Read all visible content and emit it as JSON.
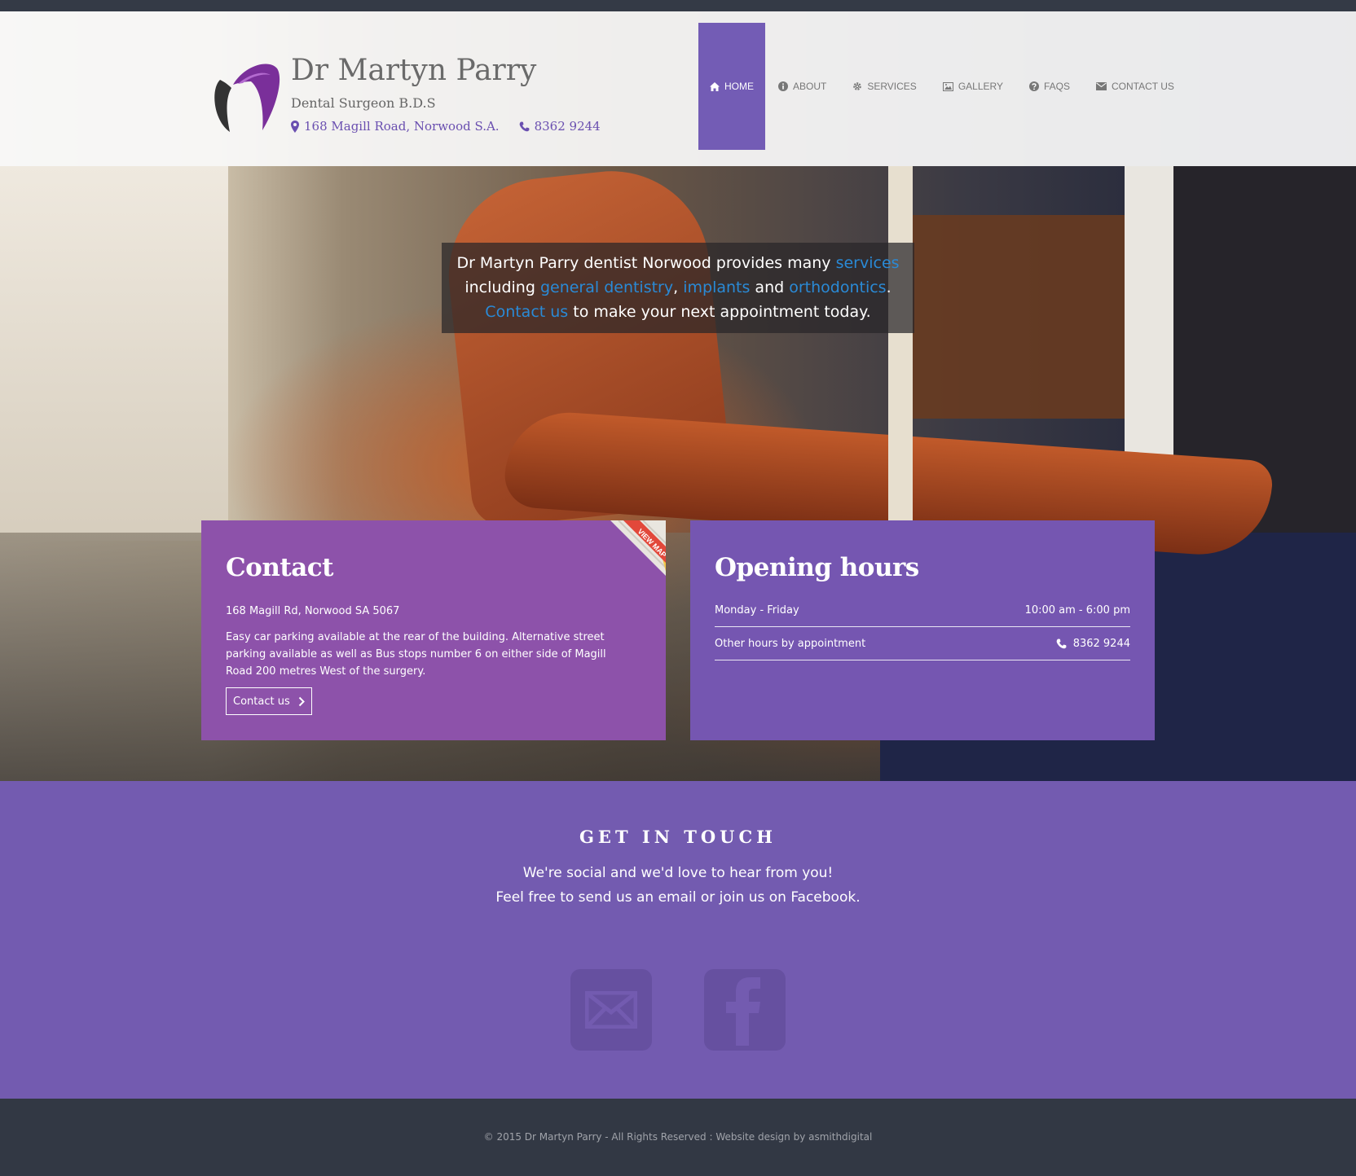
{
  "brand": {
    "name": "Dr Martyn Parry",
    "subtitle": "Dental Surgeon B.D.S",
    "address": "168 Magill Road, Norwood S.A.",
    "phone": "8362 9244",
    "accent": "#735cb5"
  },
  "nav": {
    "items": [
      {
        "label": "HOME",
        "icon": "home-icon"
      },
      {
        "label": "ABOUT",
        "icon": "info-icon"
      },
      {
        "label": "SERVICES",
        "icon": "gear-icon"
      },
      {
        "label": "GALLERY",
        "icon": "image-icon"
      },
      {
        "label": "FAQS",
        "icon": "question-icon"
      },
      {
        "label": "CONTACT US",
        "icon": "mail-icon"
      }
    ],
    "active": "HOME"
  },
  "intro": {
    "l1_a": "Dr Martyn Parry dentist Norwood provides many ",
    "l1_link": "services",
    "l2_a": "including ",
    "l2_link1": "general dentistry",
    "l2_sep": ", ",
    "l2_link2": "implants",
    "l2_b": " and ",
    "l2_link3": "orthodontics",
    "l2_end": ".",
    "l3_link": "Contact us",
    "l3_b": " to make your next appointment today."
  },
  "contact_card": {
    "title": "Contact",
    "address": "168 Magill Rd, Norwood SA 5067",
    "description": "Easy car parking available at the rear of the building. Alternative street parking available as well as Bus stops number 6 on either side of Magill Road 200 metres West of the surgery.",
    "button": "Contact us",
    "ribbon": "VIEW MAP",
    "color": "#8d52aa"
  },
  "hours_card": {
    "title": "Opening hours",
    "rows": [
      {
        "label": "Monday - Friday",
        "value": "10:00 am - 6:00 pm"
      },
      {
        "label": "Other hours by appointment",
        "value": "8362 9244"
      }
    ],
    "color": "#7556b1"
  },
  "touch": {
    "heading": "GET IN TOUCH",
    "line1": "We're social and we'd love to hear from you!",
    "line2": "Feel free to send us an email or join us on Facebook.",
    "icons": [
      "envelope-icon",
      "facebook-icon"
    ]
  },
  "footer": {
    "copyright": "© 2015 Dr Martyn Parry - All Rights Reserved : Website design by asmithdigital"
  }
}
